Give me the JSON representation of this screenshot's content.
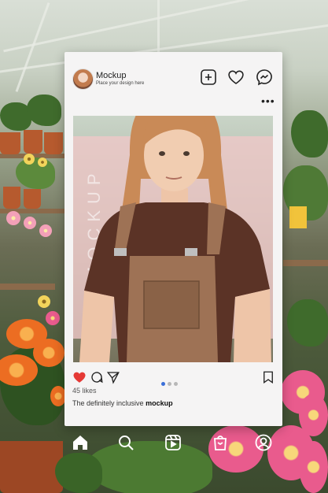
{
  "post": {
    "username": "Mockup",
    "tagline": "Place your design here",
    "watermark": "MOCKUP",
    "likes": "45 likes",
    "caption_text": "The definitely inclusive",
    "caption_bold": "mockup"
  },
  "carousel": {
    "count": 3,
    "active_index": 0
  },
  "colors": {
    "like_red": "#e53935",
    "dot_active": "#3b6fd8",
    "card_bg": "#f5f4f4"
  },
  "icons": {
    "header": [
      "add-post-icon",
      "heart-icon",
      "messenger-icon"
    ],
    "actions": [
      "like-heart-icon",
      "comment-icon",
      "share-icon",
      "bookmark-icon"
    ],
    "nav": [
      "home-icon",
      "search-icon",
      "reels-icon",
      "shop-icon",
      "profile-icon"
    ]
  }
}
